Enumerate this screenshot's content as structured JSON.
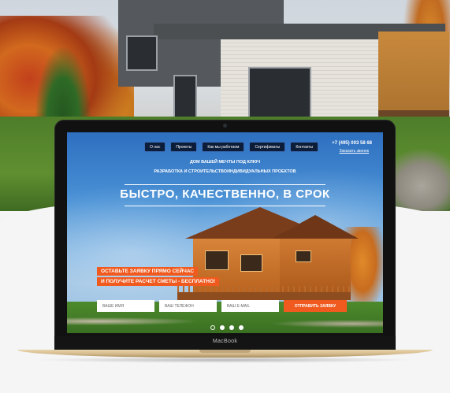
{
  "site": {
    "nav": [
      {
        "label": "О нас"
      },
      {
        "label": "Проекты"
      },
      {
        "label": "Как мы работаем"
      },
      {
        "label": "Сертификаты"
      },
      {
        "label": "Контакты"
      }
    ],
    "phone": "+7 (495) 003 58 68",
    "callback_link": "Заказать звонок",
    "tagline_1": "Дом вашей мечты под ключ",
    "tagline_2": "Разработка и строительствоиндивидуальных проектов",
    "headline": "Быстро, качественно, в срок",
    "offer_line_1": "Оставьте заявку прямо сейчас",
    "offer_line_2": "и получите расчет сметы - бесплатно!",
    "form": {
      "name_placeholder": "ваше имя",
      "phone_placeholder": "ваш телефон",
      "email_placeholder": "ваш e-mail",
      "submit_label": "отправить заявку"
    },
    "slider": {
      "count": 4,
      "active_index": 0
    }
  },
  "device": {
    "brand": "MacBook"
  },
  "colors": {
    "accent": "#f05a1e",
    "nav_bg": "#0c1d3a",
    "laptop_gold": "#d3b98a"
  }
}
